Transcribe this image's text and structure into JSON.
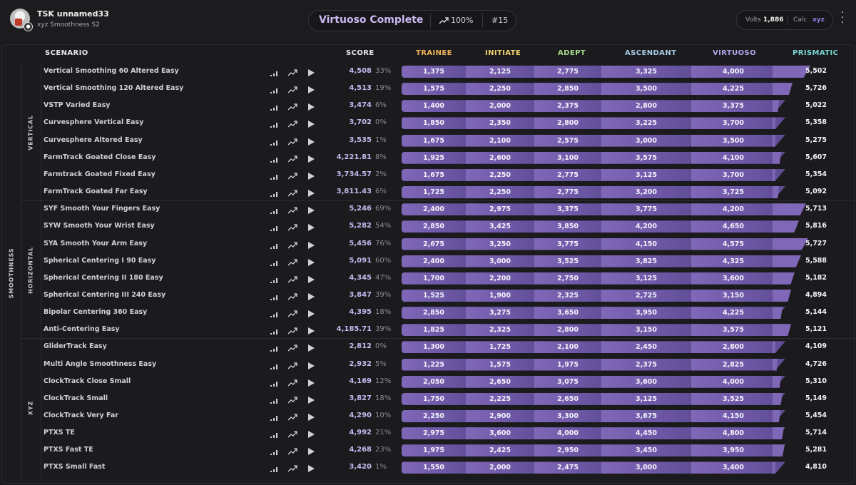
{
  "user": {
    "name": "TSK unnamed33",
    "subtitle": "xyz Smoothness S2",
    "avatar_icon": "avatar-icon"
  },
  "header": {
    "title": "Virtuoso Complete",
    "trend_icon": "trend-up-icon",
    "percent": "100%",
    "rank": "#15"
  },
  "stats": {
    "volts_label": "Volts",
    "volts_value": "1,886",
    "calc_label": "Calc",
    "calc_value": "xyz"
  },
  "colors": {
    "accent": "#8068b8",
    "title": "#c9b8f2",
    "trainee": "#f0b45a",
    "initiate": "#f0d06e",
    "adept": "#a8d88e",
    "ascendant": "#a6cbe6",
    "virtuoso": "#b3a3ec",
    "prismatic": "#77d4d2"
  },
  "table": {
    "headers": {
      "scenario": "SCENARIO",
      "score": "SCORE",
      "trainee": "TRAINEE",
      "initiate": "INITIATE",
      "adept": "ADEPT",
      "ascendant": "ASCENDANT",
      "virtuoso": "VIRTUOSO",
      "prismatic": "PRISMATIC"
    },
    "category": "SMOOTHNESS",
    "groups": [
      {
        "label": "VERTICAL",
        "rows": [
          {
            "name": "Vertical Smoothing 60 Altered Easy",
            "score": "4,508",
            "pct": "33%",
            "tr": "1,375",
            "in": "2,125",
            "ad": "2,775",
            "as": "3,325",
            "vi": "4,000",
            "pr": "5,502",
            "pfill": 0.85
          },
          {
            "name": "Vertical Smoothing 120 Altered Easy",
            "score": "4,513",
            "pct": "19%",
            "tr": "1,575",
            "in": "2,250",
            "ad": "2,850",
            "as": "3,500",
            "vi": "4,225",
            "pr": "5,726",
            "pfill": 0.45
          },
          {
            "name": "VSTP Varied Easy",
            "score": "3,474",
            "pct": "6%",
            "tr": "1,400",
            "in": "2,000",
            "ad": "2,375",
            "as": "2,800",
            "vi": "3,375",
            "pr": "5,022",
            "pfill": 0.15
          },
          {
            "name": "Curvesphere Vertical Easy",
            "score": "3,702",
            "pct": "0%",
            "tr": "1,850",
            "in": "2,350",
            "ad": "2,800",
            "as": "3,225",
            "vi": "3,700",
            "pr": "5,358",
            "pfill": 0.02
          },
          {
            "name": "Curvesphere Altered Easy",
            "score": "3,535",
            "pct": "1%",
            "tr": "1,675",
            "in": "2,100",
            "ad": "2,575",
            "as": "3,000",
            "vi": "3,500",
            "pr": "5,275",
            "pfill": 0.04
          },
          {
            "name": "FarmTrack Goated Close Easy",
            "score": "4,221.81",
            "pct": "8%",
            "tr": "1,925",
            "in": "2,600",
            "ad": "3,100",
            "as": "3,575",
            "vi": "4,100",
            "pr": "5,607",
            "pfill": 0.2
          },
          {
            "name": "Farmtrack Goated Fixed Easy",
            "score": "3,734.57",
            "pct": "2%",
            "tr": "1,675",
            "in": "2,250",
            "ad": "2,775",
            "as": "3,125",
            "vi": "3,700",
            "pr": "5,354",
            "pfill": 0.06
          },
          {
            "name": "FarmTrack Goated Far Easy",
            "score": "3,811.43",
            "pct": "6%",
            "tr": "1,725",
            "in": "2,250",
            "ad": "2,775",
            "as": "3,200",
            "vi": "3,725",
            "pr": "5,092",
            "pfill": 0.15
          }
        ]
      },
      {
        "label": "HORIZONTAL",
        "rows": [
          {
            "name": "SYF Smooth Your Fingers Easy",
            "score": "5,246",
            "pct": "69%",
            "tr": "2,400",
            "in": "2,975",
            "ad": "3,375",
            "as": "3,775",
            "vi": "4,200",
            "pr": "5,713",
            "pfill": 0.75
          },
          {
            "name": "SYW Smooth Your Wrist Easy",
            "score": "5,282",
            "pct": "54%",
            "tr": "2,850",
            "in": "3,425",
            "ad": "3,850",
            "as": "4,200",
            "vi": "4,650",
            "pr": "5,816",
            "pfill": 0.6
          },
          {
            "name": "SYA Smooth Your Arm Easy",
            "score": "5,456",
            "pct": "76%",
            "tr": "2,675",
            "in": "3,250",
            "ad": "3,775",
            "as": "4,150",
            "vi": "4,575",
            "pr": "5,727",
            "pfill": 0.8
          },
          {
            "name": "Spherical Centering I 90 Easy",
            "score": "5,091",
            "pct": "60%",
            "tr": "2,400",
            "in": "3,000",
            "ad": "3,525",
            "as": "3,825",
            "vi": "4,325",
            "pr": "5,588",
            "pfill": 0.65
          },
          {
            "name": "Spherical Centering II 180 Easy",
            "score": "4,345",
            "pct": "47%",
            "tr": "1,700",
            "in": "2,200",
            "ad": "2,750",
            "as": "3,125",
            "vi": "3,600",
            "pr": "5,182",
            "pfill": 0.5
          },
          {
            "name": "Spherical Centering III 240 Easy",
            "score": "3,847",
            "pct": "39%",
            "tr": "1,525",
            "in": "1,900",
            "ad": "2,325",
            "as": "2,725",
            "vi": "3,150",
            "pr": "4,894",
            "pfill": 0.42
          },
          {
            "name": "Bipolar Centering 360 Easy",
            "score": "4,395",
            "pct": "18%",
            "tr": "2,850",
            "in": "3,275",
            "ad": "3,650",
            "as": "3,950",
            "vi": "4,225",
            "pr": "5,144",
            "pfill": 0.22
          },
          {
            "name": "Anti-Centering Easy",
            "score": "4,185.71",
            "pct": "39%",
            "tr": "1,825",
            "in": "2,325",
            "ad": "2,800",
            "as": "3,150",
            "vi": "3,575",
            "pr": "5,121",
            "pfill": 0.42
          }
        ]
      },
      {
        "label": "XYZ",
        "rows": [
          {
            "name": "GliderTrack Easy",
            "score": "2,812",
            "pct": "0%",
            "tr": "1,300",
            "in": "1,725",
            "ad": "2,100",
            "as": "2,450",
            "vi": "2,800",
            "pr": "4,109",
            "pfill": 0.02
          },
          {
            "name": "Multi Angle Smoothness Easy",
            "score": "2,932",
            "pct": "5%",
            "tr": "1,225",
            "in": "1,575",
            "ad": "1,975",
            "as": "2,375",
            "vi": "2,825",
            "pr": "4,726",
            "pfill": 0.12
          },
          {
            "name": "ClockTrack Close Small",
            "score": "4,169",
            "pct": "12%",
            "tr": "2,050",
            "in": "2,650",
            "ad": "3,075",
            "as": "3,600",
            "vi": "4,000",
            "pr": "5,310",
            "pfill": 0.2
          },
          {
            "name": "ClockTrack Small",
            "score": "3,827",
            "pct": "18%",
            "tr": "1,750",
            "in": "2,225",
            "ad": "2,650",
            "as": "3,125",
            "vi": "3,525",
            "pr": "5,149",
            "pfill": 0.22
          },
          {
            "name": "ClockTrack Very Far",
            "score": "4,290",
            "pct": "10%",
            "tr": "2,250",
            "in": "2,900",
            "ad": "3,300",
            "as": "3,675",
            "vi": "4,150",
            "pr": "5,454",
            "pfill": 0.18
          },
          {
            "name": "PTXS TE",
            "score": "4,992",
            "pct": "21%",
            "tr": "2,975",
            "in": "3,600",
            "ad": "4,000",
            "as": "4,450",
            "vi": "4,800",
            "pr": "5,714",
            "pfill": 0.25
          },
          {
            "name": "PTXS Fast TE",
            "score": "4,268",
            "pct": "23%",
            "tr": "1,975",
            "in": "2,425",
            "ad": "2,950",
            "as": "3,450",
            "vi": "3,950",
            "pr": "5,281",
            "pfill": 0.28
          },
          {
            "name": "PTXS Small Fast",
            "score": "3,420",
            "pct": "1%",
            "tr": "1,550",
            "in": "2,000",
            "ad": "2,475",
            "as": "3,000",
            "vi": "3,400",
            "pr": "4,810",
            "pfill": 0.04
          }
        ]
      }
    ],
    "row_icons": [
      "leaderboard-icon",
      "trend-icon",
      "play-icon"
    ]
  }
}
